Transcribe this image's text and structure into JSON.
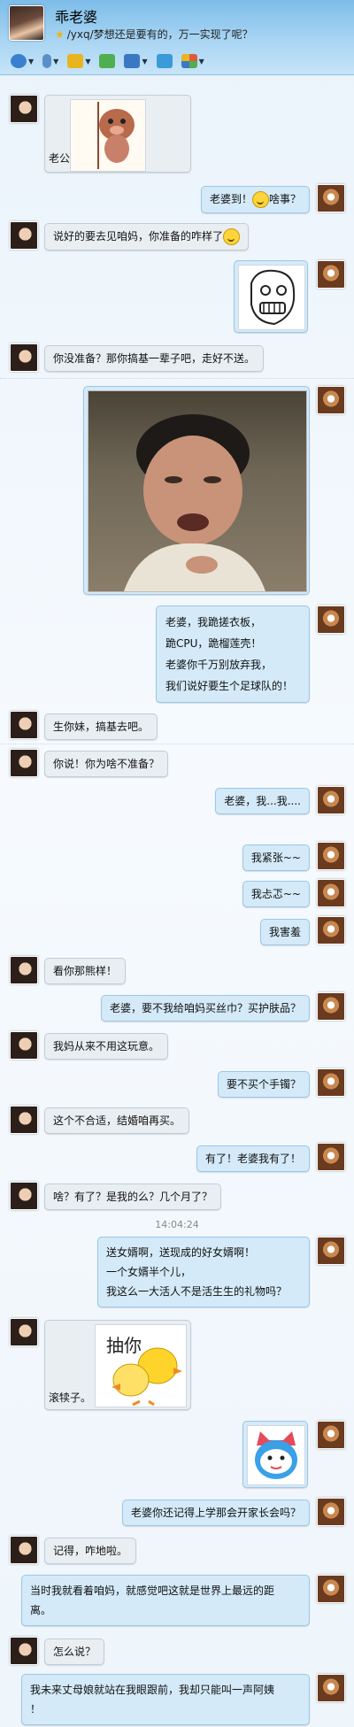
{
  "header": {
    "name": "乖老婆",
    "signature": "/yxq/梦想还是要有的，万一实现了呢？",
    "toolbar": [
      {
        "icon": "camera-icon",
        "color": "#3a7fd0"
      },
      {
        "icon": "microphone-icon",
        "color": "#5b8fc7"
      },
      {
        "icon": "file-transfer-icon",
        "color": "#e8b520"
      },
      {
        "icon": "add-contact-icon",
        "color": "#4fae4f"
      },
      {
        "icon": "screen-share-icon",
        "color": "#3b78c4"
      },
      {
        "icon": "remote-desktop-icon",
        "color": "#3b9ad8"
      },
      {
        "icon": "apps-icon",
        "color": "#e05a3a"
      }
    ]
  },
  "messages": [
    {
      "from": "her",
      "text": "老公",
      "sticker": "pig-sticker"
    },
    {
      "from": "me",
      "text": "老婆到！",
      "text2": "啥事？"
    },
    {
      "from": "her",
      "text": "说好的要去见咱妈，你准备的咋样了"
    },
    {
      "from": "me",
      "sticker": "rage-face-sticker"
    },
    {
      "from": "her",
      "text": "你没准备？那你搞基一辈子吧，走好不送。"
    },
    {
      "from": "me",
      "sticker": "crying-man-photo"
    },
    {
      "from": "me",
      "lines": [
        "老婆，我跪搓衣板，",
        "跪CPU，跪榴莲壳！",
        "老婆你千万别放弃我，",
        "我们说好要生个足球队的！"
      ]
    },
    {
      "from": "her",
      "text": "生你妹，搞基去吧。"
    },
    {
      "from": "her",
      "text": "你说！你为啥不准备？"
    },
    {
      "from": "me",
      "text": "老婆，我...我...."
    },
    {
      "from": "me",
      "text": "我紧张~~"
    },
    {
      "from": "me",
      "text": "我忐忑~~"
    },
    {
      "from": "me",
      "text": "我害羞"
    },
    {
      "from": "her",
      "text": "看你那熊样！"
    },
    {
      "from": "me",
      "text": "老婆，要不我给咱妈买丝巾？买护肤品？"
    },
    {
      "from": "her",
      "text": "我妈从来不用这玩意。"
    },
    {
      "from": "me",
      "text": "要不买个手镯？"
    },
    {
      "from": "her",
      "text": "这个不合适，结婚咱再买。"
    },
    {
      "from": "me",
      "text": "有了！老婆我有了！"
    },
    {
      "from": "her",
      "text": "啥？有了？是我的么？几个月了？"
    },
    {
      "from": "me",
      "lines": [
        "送女婿啊，送现成的好女婿啊！",
        "一个女婿半个儿，",
        "我这么一大活人不是活生生的礼物吗？"
      ]
    },
    {
      "from": "her",
      "text": "滚犊子。",
      "sticker": "duck-sticker",
      "sticker_text": "抽你"
    },
    {
      "from": "me",
      "sticker": "cat-sticker"
    },
    {
      "from": "me",
      "text": "老婆你还记得上学那会开家长会吗？"
    },
    {
      "from": "her",
      "text": "记得，咋地啦。"
    },
    {
      "from": "me",
      "lines": [
        "当时我就看着咱妈，就感觉吧这就是世界上最远的距",
        "离。"
      ]
    },
    {
      "from": "her",
      "text": "怎么说？"
    },
    {
      "from": "me",
      "lines": [
        "我未来丈母娘就站在我眼跟前，我却只能叫一声阿姨",
        "！"
      ]
    }
  ],
  "timestamp": "14:04:24"
}
